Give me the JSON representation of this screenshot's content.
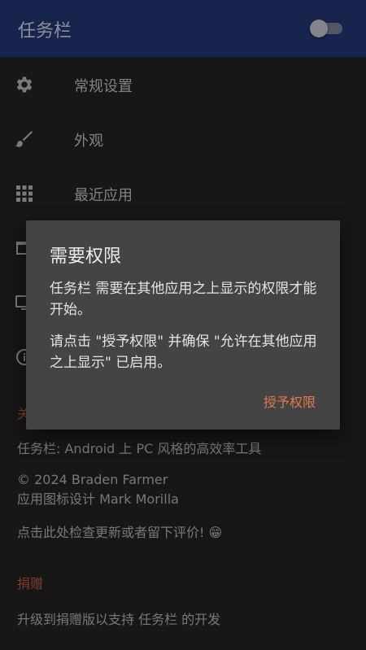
{
  "appbar": {
    "title": "任务栏",
    "toggle_state": "off"
  },
  "menu": [
    {
      "label": "常规设置",
      "icon": "gear-icon"
    },
    {
      "label": "外观",
      "icon": "paintbrush-icon"
    },
    {
      "label": "最近应用",
      "icon": "grid-icon"
    },
    {
      "label": "",
      "icon": "window-icon"
    },
    {
      "label": "",
      "icon": "desktop-icon"
    },
    {
      "label": "",
      "icon": "info-icon"
    }
  ],
  "about": {
    "header": "关",
    "line1": "任务栏: Android 上 PC 风格的高效率工具",
    "line2": "© 2024 Braden Farmer",
    "line3": "应用图标设计 Mark Morilla",
    "line4": "点击此处检查更新或者留下评价! 😁"
  },
  "donate": {
    "header": "捐赠",
    "text": "升级到捐赠版以支持 任务栏 的开发"
  },
  "dialog": {
    "title": "需要权限",
    "body1": "任务栏 需要在其他应用之上显示的权限才能开始。",
    "body2": "请点击 \"授予权限\" 并确保 \"允许在其他应用之上显示\" 已启用。",
    "button": "授予权限"
  },
  "colors": {
    "appbar": "#243a78",
    "accent": "#e07a4e",
    "background": "#242424",
    "dialog": "#444444"
  }
}
